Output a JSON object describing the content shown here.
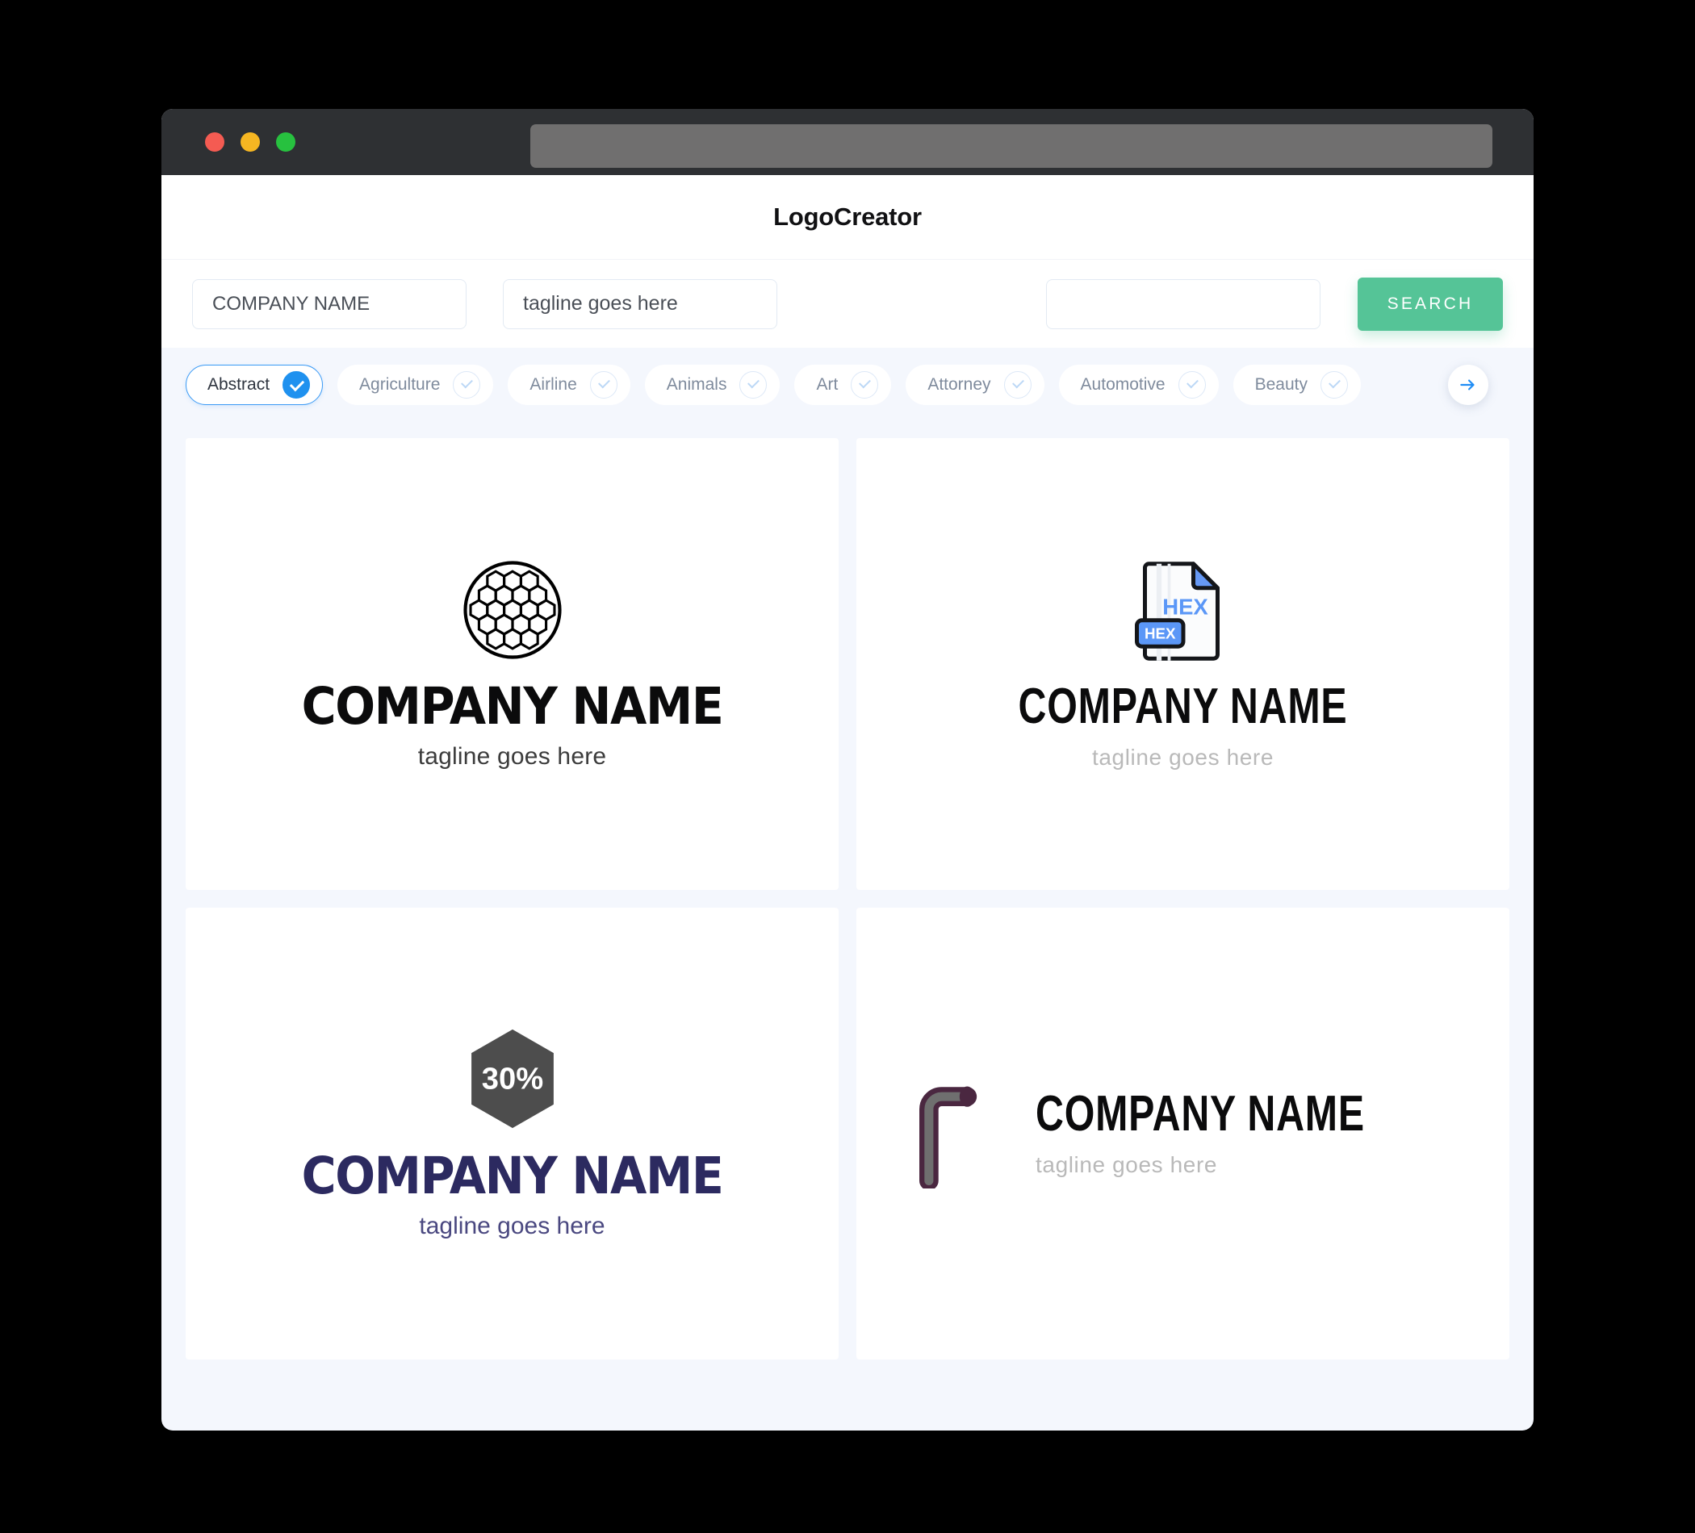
{
  "browser": {
    "traffic_lights": [
      "close-red",
      "minimize-yellow",
      "maximize-green"
    ],
    "url_value": ""
  },
  "header": {
    "title": "LogoCreator"
  },
  "search": {
    "company_value": "COMPANY NAME",
    "company_placeholder": "COMPANY NAME",
    "tagline_value": "tagline goes here",
    "tagline_placeholder": "tagline goes here",
    "extra_value": "",
    "extra_placeholder": "",
    "button_label": "SEARCH",
    "button_color": "#55c497"
  },
  "categories": {
    "next_icon": "arrow-right-icon",
    "items": [
      {
        "label": "Abstract",
        "selected": true
      },
      {
        "label": "Agriculture",
        "selected": false
      },
      {
        "label": "Airline",
        "selected": false
      },
      {
        "label": "Animals",
        "selected": false
      },
      {
        "label": "Art",
        "selected": false
      },
      {
        "label": "Attorney",
        "selected": false
      },
      {
        "label": "Automotive",
        "selected": false
      },
      {
        "label": "Beauty",
        "selected": false
      }
    ],
    "active_color": "#1f91ef"
  },
  "results": [
    {
      "icon": "honeycomb-circle-icon",
      "company": "COMPANY NAME",
      "tagline": "tagline goes here",
      "text_color": "#0b0b0c",
      "layout": "stacked"
    },
    {
      "icon": "hex-file-icon",
      "icon_text": "HEX",
      "icon_badge_text": "HEX",
      "company": "COMPANY NAME",
      "tagline": "tagline goes here",
      "text_color": "#0b0b0c",
      "accent_color": "#5b97f7",
      "layout": "stacked"
    },
    {
      "icon": "hexagon-percent-icon",
      "icon_text": "30%",
      "company": "COMPANY NAME",
      "tagline": "tagline goes here",
      "text_color": "#2c2a60",
      "icon_color": "#4d4d4d",
      "layout": "stacked"
    },
    {
      "icon": "allen-key-icon",
      "company": "COMPANY NAME",
      "tagline": "tagline goes here",
      "text_color": "#0b0b0c",
      "icon_color": "#4a2740",
      "layout": "horizontal"
    }
  ]
}
